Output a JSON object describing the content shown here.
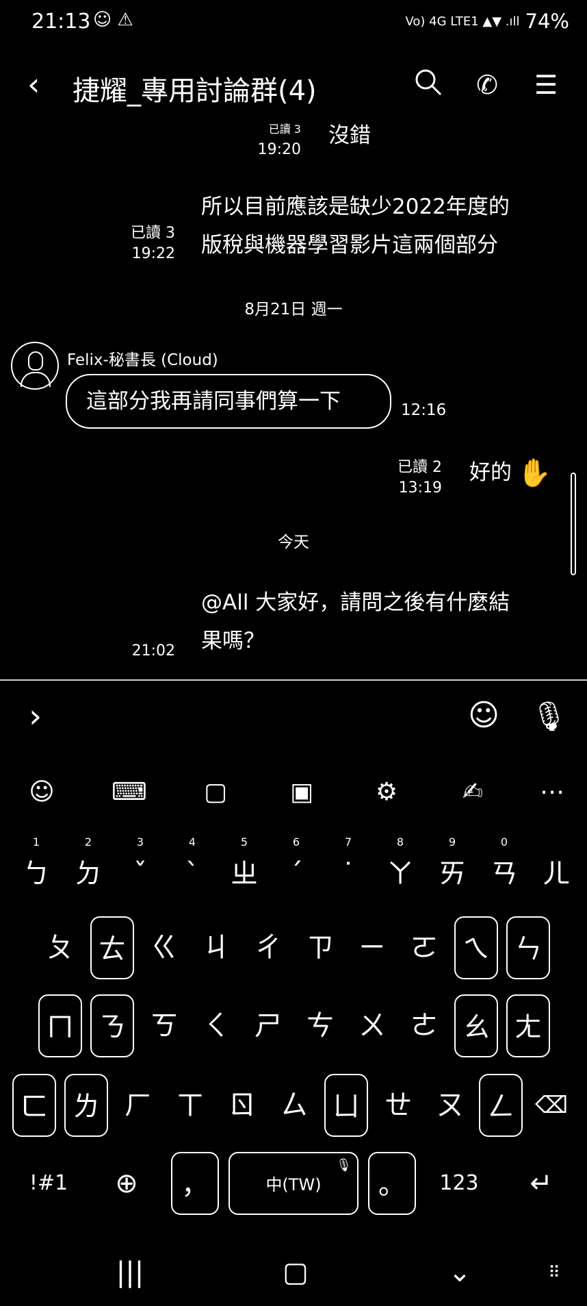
{
  "status_bar": {
    "time": "21:13",
    "left_icons": "☺ ⚠",
    "signal": "Vo) 4G LTE1 ▲▼ .ıll",
    "battery": "74%"
  },
  "header": {
    "title": "捷耀_專用討論群(4)",
    "back_icon": "chevron-left",
    "search_icon": "search",
    "call_icon": "phone",
    "menu_icon": "menu"
  },
  "chat": {
    "messages": [
      {
        "read": "已讀 3",
        "time": "19:20",
        "text": "沒錯"
      },
      {
        "read": "已讀 3",
        "time": "19:22",
        "line1": "所以目前應該是缺少2022年度的",
        "line2": "版稅與機器學習影片這兩個部分"
      }
    ],
    "date1": "8月21日 週一",
    "incoming": {
      "sender": "Felix-秘書長 (Cloud)",
      "text": "這部分我再請同事們算一下",
      "time": "12:16"
    },
    "reply": {
      "read": "已讀 2",
      "time": "13:19",
      "text": "好的"
    },
    "date2": "今天",
    "last": {
      "time": "21:02",
      "line1": "@All 大家好，請問之後有什麼結",
      "line2": "果嗎？"
    }
  },
  "keyboard": {
    "row0": [
      {
        "k": "ㄅ",
        "n": "1"
      },
      {
        "k": "ㄉ",
        "n": "2"
      },
      {
        "k": "ˇ",
        "n": "3"
      },
      {
        "k": "ˋ",
        "n": "4"
      },
      {
        "k": "ㄓ",
        "n": "5"
      },
      {
        "k": "ˊ",
        "n": "6"
      },
      {
        "k": "˙",
        "n": "7"
      },
      {
        "k": "ㄚ",
        "n": "8"
      },
      {
        "k": "ㄞ",
        "n": "9"
      },
      {
        "k": "ㄢ",
        "n": "0"
      },
      {
        "k": "ㄦ",
        "n": ""
      }
    ],
    "row1": [
      "ㄆ",
      "ㄊ",
      "ㄍ",
      "ㄐ",
      "ㄔ",
      "ㄗ",
      "ㄧ",
      "ㄛ",
      "ㄟ",
      "ㄣ"
    ],
    "row2": [
      "ㄇ",
      "ㄋ",
      "ㄎ",
      "ㄑ",
      "ㄕ",
      "ㄘ",
      "ㄨ",
      "ㄜ",
      "ㄠ",
      "ㄤ"
    ],
    "row3": [
      "ㄈ",
      "ㄌ",
      "ㄏ",
      "ㄒ",
      "ㄖ",
      "ㄙ",
      "ㄩ",
      "ㄝ",
      "ㄡ",
      "ㄥ"
    ],
    "sym": "!#1",
    "comma": "，",
    "space": "中(TW)",
    "period": "。",
    "num": "123"
  },
  "colors": {
    "background": "#000000",
    "foreground": "#ffffff"
  }
}
